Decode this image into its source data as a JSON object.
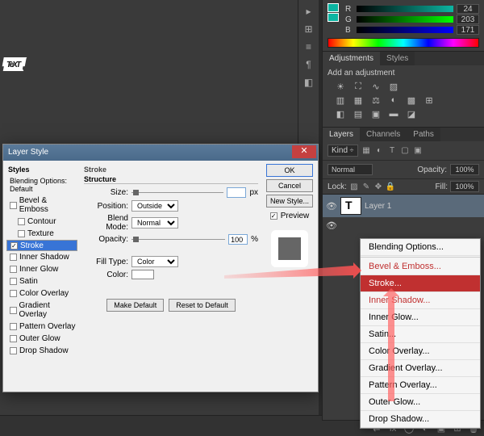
{
  "canvas": {
    "text": "TeXT"
  },
  "dialog": {
    "title": "Layer Style",
    "ok": "OK",
    "cancel": "Cancel",
    "newstyle": "New Style...",
    "preview": "Preview",
    "styles_hdr": "Styles",
    "blending_default": "Blending Options: Default",
    "effects": [
      "Bevel & Emboss",
      "Contour",
      "Texture",
      "Stroke",
      "Inner Shadow",
      "Inner Glow",
      "Satin",
      "Color Overlay",
      "Gradient Overlay",
      "Pattern Overlay",
      "Outer Glow",
      "Drop Shadow"
    ],
    "selected": "Stroke",
    "stroke": {
      "hdr": "Stroke",
      "structure": "Structure",
      "size_lbl": "Size:",
      "size_val": "",
      "size_unit": "px",
      "pos_lbl": "Position:",
      "pos_val": "Outside",
      "blend_lbl": "Blend Mode:",
      "blend_val": "Normal",
      "opac_lbl": "Opacity:",
      "opac_val": "100",
      "opac_unit": "%",
      "filltype_lbl": "Fill Type:",
      "filltype_val": "Color",
      "color_lbl": "Color:",
      "make_default": "Make Default",
      "reset_default": "Reset to Default"
    }
  },
  "color": {
    "r_lbl": "R",
    "g_lbl": "G",
    "b_lbl": "B",
    "r": "24",
    "g": "203",
    "b": "171"
  },
  "adjustments": {
    "tab1": "Adjustments",
    "tab2": "Styles",
    "label": "Add an adjustment"
  },
  "layers": {
    "tab1": "Layers",
    "tab2": "Channels",
    "tab3": "Paths",
    "kind": "Kind",
    "blend": "Normal",
    "opacity_lbl": "Opacity:",
    "opacity": "100%",
    "lock_lbl": "Lock:",
    "fill_lbl": "Fill:",
    "fill": "100%",
    "layer1": "Layer 1"
  },
  "fx_menu": {
    "items": [
      "Blending Options...",
      "Bevel & Emboss...",
      "Stroke...",
      "Inner Shadow...",
      "Inner Glow...",
      "Satin...",
      "Color Overlay...",
      "Gradient Overlay...",
      "Pattern Overlay...",
      "Outer Glow...",
      "Drop Shadow..."
    ]
  }
}
